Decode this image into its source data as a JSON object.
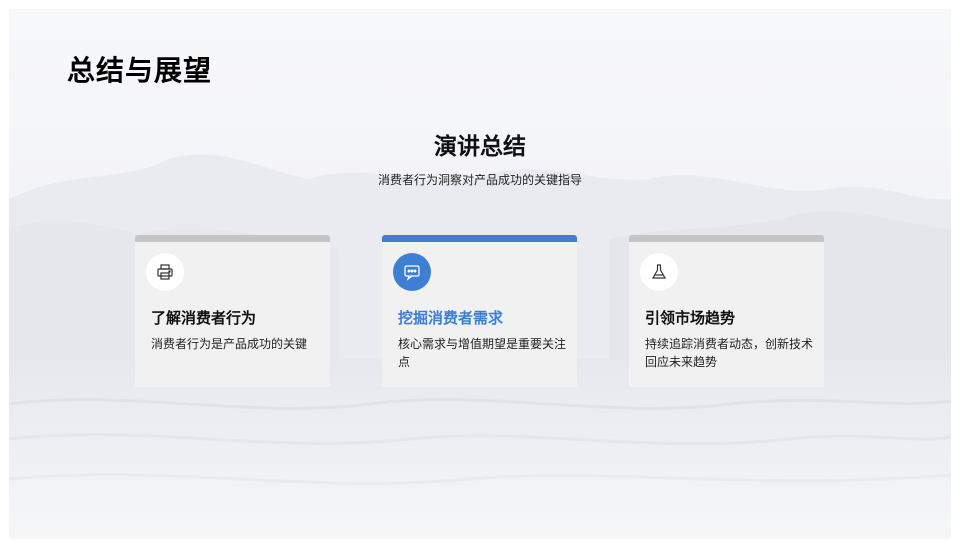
{
  "page": {
    "title": "总结与展望"
  },
  "summary": {
    "title": "演讲总结",
    "subtitle": "消费者行为洞察对产品成功的关键指导"
  },
  "cards": [
    {
      "icon": "printer-icon",
      "title": "了解消费者行为",
      "description": "消费者行为是产品成功的关键",
      "active": false
    },
    {
      "icon": "chat-bubble-icon",
      "title": "挖掘消费者需求",
      "description": "核心需求与增值期望是重要关注点",
      "active": true
    },
    {
      "icon": "flask-icon",
      "title": "引领市场趋势",
      "description": "持续追踪消费者动态，创新技术回应未来趋势",
      "active": false
    }
  ],
  "colors": {
    "accent": "#3d7fd3",
    "card_background": "#f1f1f2",
    "card_top_bar": "#c4c4c4"
  }
}
